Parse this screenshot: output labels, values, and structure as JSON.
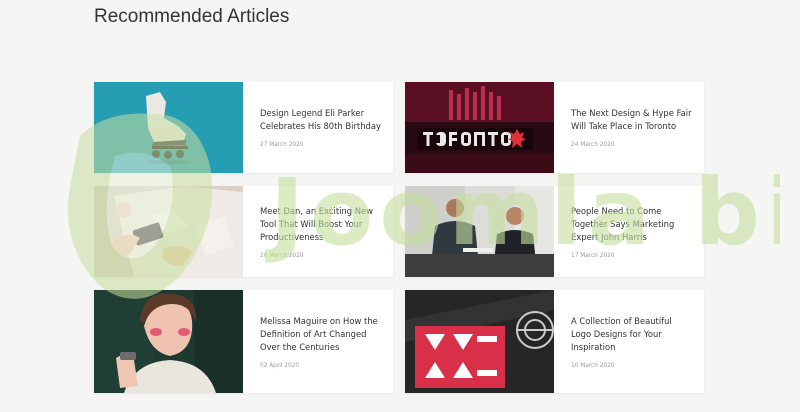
{
  "section": {
    "title": "Recommended Articles"
  },
  "articles": [
    {
      "title": "Design Legend Eli Parker Celebrates His 80th Birthday",
      "date": "27 March 2020",
      "image": "roller-skate-on-teal"
    },
    {
      "title": "The Next Design & Hype Fair Will Take Place in Toronto",
      "date": "24 March 2020",
      "image": "toronto-sign-at-night"
    },
    {
      "title": "Meet Dan, an Exciting New Tool That Will Boost Your Productiveness",
      "date": "20 March 2020",
      "image": "hands-with-phone-on-table"
    },
    {
      "title": "People Need to Come Together Says Marketing Expert John Harris",
      "date": "17 March 2020",
      "image": "people-at-meeting"
    },
    {
      "title": "Melissa Maguire on How the Definition of Art Changed Over the Centuries",
      "date": "02 April 2020",
      "image": "woman-portrait-red-background"
    },
    {
      "title": "A Collection of Beautiful Logo Designs for Your Inspiration",
      "date": "10 March 2020",
      "image": "red-geometric-logo"
    }
  ],
  "watermark": {
    "text": "Joomla bid",
    "color": "#c8dfa0"
  }
}
